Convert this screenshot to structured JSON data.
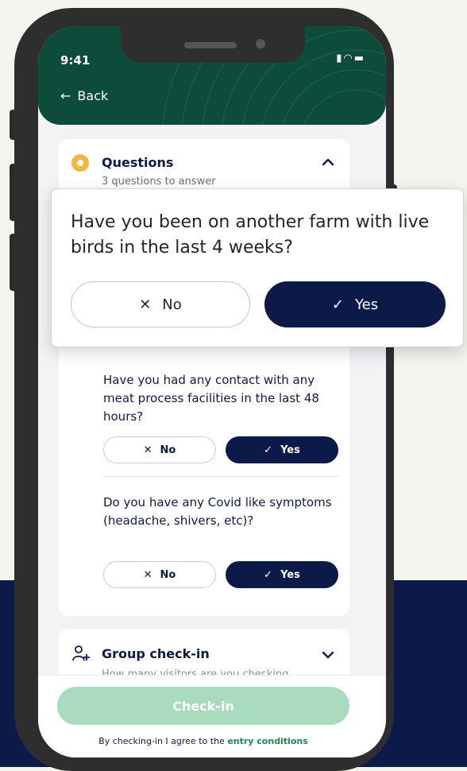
{
  "status_bar": {
    "time": "9:41",
    "icons": "▮▮▮ ◠ ▬"
  },
  "header": {
    "back_label": "Back",
    "back_arrow": "←"
  },
  "questions_card": {
    "title": "Questions",
    "subtitle": "3 questions to answer",
    "items": [
      {
        "text": "Have you had any contact with any meat process facilities in the last 48 hours?",
        "no_label": "No",
        "yes_label": "Yes",
        "selected": "Yes"
      },
      {
        "text": "Do you have any Covid like symptoms (headache, shivers, etc)?",
        "no_label": "No",
        "yes_label": "Yes",
        "selected": "Yes"
      }
    ]
  },
  "popup_question": {
    "text": "Have you been on another farm with live birds in the last 4 weeks?",
    "no_label": "No",
    "yes_label": "Yes",
    "selected": "Yes"
  },
  "group_card": {
    "title": "Group check-in",
    "subtitle": "How many visitors are you checking"
  },
  "footer": {
    "checkin_label": "Check-in",
    "terms_prefix": "By checking-in I agree to the",
    "terms_link": "entry conditions"
  },
  "colors": {
    "navy": "#0c1a4a",
    "header_green": "#0d4b3a",
    "checkin_green": "#a9dbbe",
    "link_green": "#1b8a4e",
    "question_dot": "#f4b63f"
  },
  "icons": {
    "check": "check-icon",
    "cross": "close-icon",
    "chevron_up": "chevron-up-icon",
    "chevron_down": "chevron-down-icon",
    "group": "group-add-icon"
  }
}
